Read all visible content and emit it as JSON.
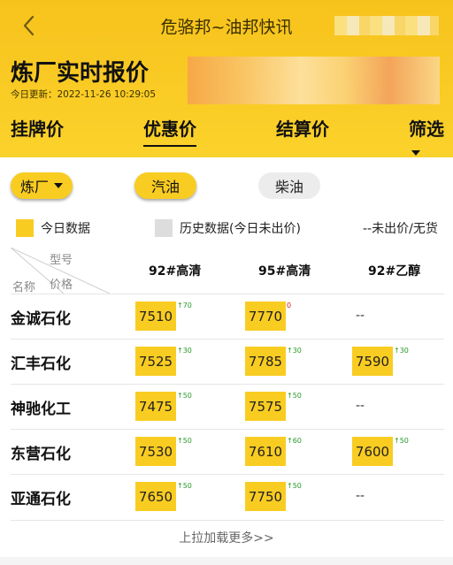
{
  "nav": {
    "title": "危骆邦~油邦快讯"
  },
  "page": {
    "title": "炼厂实时报价",
    "update_time": "今日更新：2022-11-26 10:29:05"
  },
  "tabs": [
    {
      "label": "挂牌价"
    },
    {
      "label": "优惠价",
      "active": true
    },
    {
      "label": "结算价"
    },
    {
      "label": "筛选"
    }
  ],
  "filters": {
    "refinery": "炼厂",
    "gasoline": "汽油",
    "diesel": "柴油"
  },
  "legend": {
    "today": "今日数据",
    "history": "历史数据(今日未出价)",
    "none": "--未出价/无货",
    "today_color": "#f9cc22",
    "history_color": "#dddddd"
  },
  "table": {
    "corner_top": "型号",
    "corner_bottom_left": "名称",
    "corner_bottom_right": "价格",
    "columns": [
      "92#高清",
      "95#高清",
      "92#乙醇"
    ],
    "rows": [
      {
        "name": "金诚石化",
        "cells": [
          {
            "price": "7510",
            "change": "↑70",
            "dir": "up"
          },
          {
            "price": "7770",
            "change": "0",
            "dir": "red"
          },
          {
            "price": "--"
          }
        ]
      },
      {
        "name": "汇丰石化",
        "cells": [
          {
            "price": "7525",
            "change": "↑30",
            "dir": "up"
          },
          {
            "price": "7785",
            "change": "↑30",
            "dir": "up"
          },
          {
            "price": "7590",
            "change": "↑30",
            "dir": "up"
          }
        ]
      },
      {
        "name": "神驰化工",
        "cells": [
          {
            "price": "7475",
            "change": "↑50",
            "dir": "up"
          },
          {
            "price": "7575",
            "change": "↑50",
            "dir": "up"
          },
          {
            "price": "--"
          }
        ]
      },
      {
        "name": "东营石化",
        "cells": [
          {
            "price": "7530",
            "change": "↑50",
            "dir": "up"
          },
          {
            "price": "7610",
            "change": "↑60",
            "dir": "up"
          },
          {
            "price": "7600",
            "change": "↑50",
            "dir": "up"
          }
        ]
      },
      {
        "name": "亚通石化",
        "cells": [
          {
            "price": "7650",
            "change": "↑50",
            "dir": "up"
          },
          {
            "price": "7750",
            "change": "↑50",
            "dir": "up"
          },
          {
            "price": "--"
          }
        ]
      }
    ]
  },
  "footer": {
    "load_more": "上拉加载更多>>"
  }
}
